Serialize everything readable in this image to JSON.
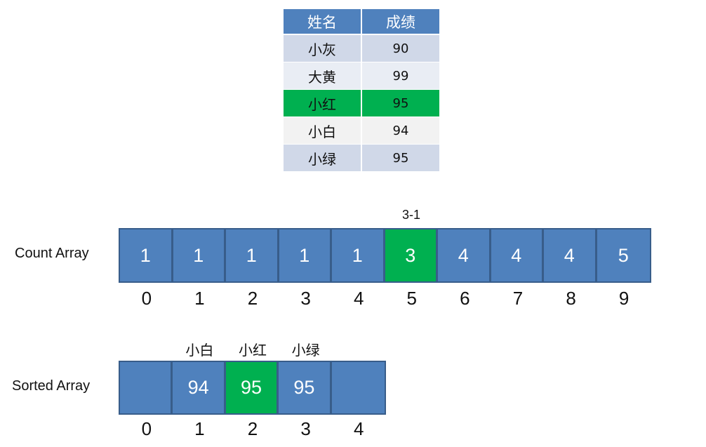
{
  "table": {
    "headers": [
      "姓名",
      "成绩"
    ],
    "rows": [
      {
        "name": "小灰",
        "score": "90"
      },
      {
        "name": "大黄",
        "score": "99"
      },
      {
        "name": "小红",
        "score": "95",
        "highlight": true
      },
      {
        "name": "小白",
        "score": "94"
      },
      {
        "name": "小绿",
        "score": "95"
      }
    ]
  },
  "count_array": {
    "label": "Count Array",
    "annotation": "3-1",
    "values": [
      "1",
      "1",
      "1",
      "1",
      "1",
      "3",
      "4",
      "4",
      "4",
      "5"
    ],
    "indices": [
      "0",
      "1",
      "2",
      "3",
      "4",
      "5",
      "6",
      "7",
      "8",
      "9"
    ],
    "highlight_index": 5
  },
  "sorted_array": {
    "label": "Sorted Array",
    "values": [
      "",
      "94",
      "95",
      "95",
      ""
    ],
    "names": [
      "",
      "小白",
      "小红",
      "小绿",
      ""
    ],
    "indices": [
      "0",
      "1",
      "2",
      "3",
      "4"
    ],
    "highlight_index": 2
  },
  "colors": {
    "cell_blue": "#4f81bd",
    "cell_border": "#385d8a",
    "highlight_green": "#00b050",
    "row_light": "#d0d8e8",
    "row_lighter": "#e9edf4"
  }
}
